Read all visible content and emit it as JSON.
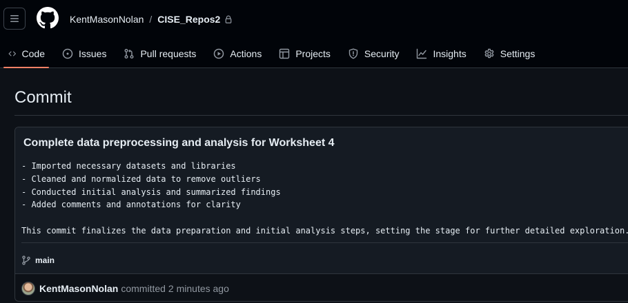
{
  "header": {
    "owner": "KentMasonNolan",
    "separator": "/",
    "repo": "CISE_Repos2"
  },
  "tabs": [
    {
      "label": "Code",
      "icon": "code-icon",
      "active": true
    },
    {
      "label": "Issues",
      "icon": "issue-opened-icon"
    },
    {
      "label": "Pull requests",
      "icon": "git-pull-request-icon"
    },
    {
      "label": "Actions",
      "icon": "play-icon"
    },
    {
      "label": "Projects",
      "icon": "table-icon"
    },
    {
      "label": "Security",
      "icon": "shield-icon"
    },
    {
      "label": "Insights",
      "icon": "graph-icon"
    },
    {
      "label": "Settings",
      "icon": "gear-icon"
    }
  ],
  "page": {
    "title": "Commit"
  },
  "commit": {
    "title": "Complete data preprocessing and analysis for Worksheet 4",
    "body_lines": [
      "- Imported necessary datasets and libraries",
      "- Cleaned and normalized data to remove outliers",
      "- Conducted initial analysis and summarized findings",
      "- Added comments and annotations for clarity",
      "",
      "This commit finalizes the data preparation and initial analysis steps, setting the stage for further detailed exploration."
    ],
    "branch": "main",
    "author": "KentMasonNolan",
    "action": "committed",
    "time": "2 minutes ago"
  },
  "colors": {
    "header_bg": "#010409",
    "page_bg": "#0d1117",
    "border": "#30363d",
    "active_tab_underline": "#f78166",
    "muted_text": "#9198a1"
  }
}
